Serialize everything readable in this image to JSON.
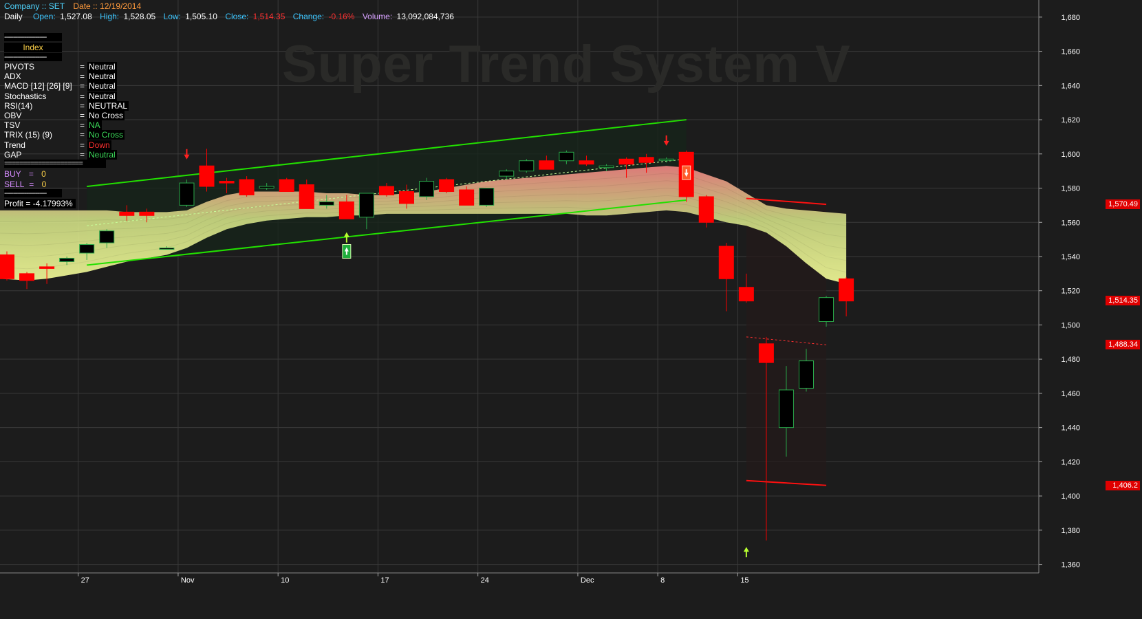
{
  "header": {
    "company_label": "Company :: SET",
    "date_label": "Date :: 12/19/2014",
    "period": "Daily",
    "open_label": "Open:",
    "open": "1,527.08",
    "high_label": "High:",
    "high": "1,528.05",
    "low_label": "Low:",
    "low": "1,505.10",
    "close_label": "Close:",
    "close": "1,514.35",
    "change_label": "Change:",
    "change": "-0.16%",
    "volume_label": "Volume:",
    "volume": "13,092,084,736"
  },
  "watermark": "Super Trend System V",
  "panel": {
    "sep1": "-----------------------",
    "index_label": "Index",
    "sep2": "-----------------------",
    "rows": [
      {
        "key": "PIVOTS",
        "eq": "=",
        "value": "Neutral",
        "color": "#ffffff"
      },
      {
        "key": "ADX",
        "eq": "=",
        "value": "Neutral",
        "color": "#ffffff"
      },
      {
        "key": "MACD [12] [26] [9]",
        "eq": "=",
        "value": "Neutral",
        "color": "#ffffff"
      },
      {
        "key": "Stochastics",
        "eq": "=",
        "value": "Neutral",
        "color": "#ffffff"
      },
      {
        "key": "RSI(14)",
        "eq": "=",
        "value": "NEUTRAL",
        "color": "#ffffff"
      },
      {
        "key": "OBV",
        "eq": "=",
        "value": "No Cross",
        "color": "#ffffff"
      },
      {
        "key": "TSV",
        "eq": "=",
        "value": "NA",
        "color": "#3cdc5a"
      },
      {
        "key": "TRIX (15) (9)",
        "eq": "=",
        "value": "No Cross",
        "color": "#3cdc5a"
      },
      {
        "key": "Trend",
        "eq": "=",
        "value": "Down",
        "color": "#ff3030"
      },
      {
        "key": "GAP",
        "eq": "=",
        "value": "Neutral",
        "color": "#3cdc5a"
      }
    ],
    "sep3": "=====================",
    "buy_label": "BUY",
    "buy_eq": "=",
    "buy_value": "0",
    "sell_label": "SELL",
    "sell_eq": "=",
    "sell_value": "0",
    "sep4": "-----------------------",
    "profit": "Profit = -4.17993%"
  },
  "price_tags": [
    {
      "text": "1,570.49",
      "value": 1570.49,
      "color": "#e00000"
    },
    {
      "text": "1,514.35",
      "value": 1514.35,
      "color": "#e00000"
    },
    {
      "text": "1,488.34",
      "value": 1488.34,
      "color": "#e00000"
    },
    {
      "text": "1,406.2",
      "value": 1406.2,
      "color": "#e00000"
    }
  ],
  "colors": {
    "background": "#1c1c1c",
    "grid": "#3a3a3a",
    "up": "#000000",
    "down": "#ff0000",
    "channel": "#22e000",
    "axis_text": "#ffffff"
  },
  "chart_data": {
    "type": "candlestick",
    "title": "Super Trend System V",
    "ylim": [
      1355,
      1690
    ],
    "yticks": [
      1360,
      1380,
      1400,
      1420,
      1440,
      1460,
      1480,
      1500,
      1520,
      1540,
      1560,
      1580,
      1600,
      1620,
      1640,
      1660,
      1680
    ],
    "ytick_labels": [
      "1,360",
      "1,380",
      "1,400",
      "1,420",
      "1,440",
      "1,460",
      "1,480",
      "1,500",
      "1,520",
      "1,540",
      "1,560",
      "1,580",
      "1,600",
      "1,620",
      "1,640",
      "1,660",
      "1,680"
    ],
    "xtick_labels": [
      {
        "label": "27",
        "index": 4
      },
      {
        "label": "Nov",
        "index": 9
      },
      {
        "label": "10",
        "index": 14
      },
      {
        "label": "17",
        "index": 19
      },
      {
        "label": "24",
        "index": 24
      },
      {
        "label": "Dec",
        "index": 29
      },
      {
        "label": "8",
        "index": 33
      },
      {
        "label": "15",
        "index": 37
      }
    ],
    "candles": [
      {
        "o": 1541,
        "h": 1543,
        "l": 1526,
        "c": 1527
      },
      {
        "o": 1530,
        "h": 1531,
        "l": 1521,
        "c": 1526
      },
      {
        "o": 1534,
        "h": 1536,
        "l": 1524,
        "c": 1533
      },
      {
        "o": 1537,
        "h": 1540,
        "l": 1535,
        "c": 1539
      },
      {
        "o": 1542,
        "h": 1548,
        "l": 1538,
        "c": 1547
      },
      {
        "o": 1548,
        "h": 1556,
        "l": 1545,
        "c": 1555
      },
      {
        "o": 1566,
        "h": 1570,
        "l": 1561,
        "c": 1564
      },
      {
        "o": 1566,
        "h": 1568,
        "l": 1560,
        "c": 1564
      },
      {
        "o": 1545,
        "h": 1546,
        "l": 1544,
        "c": 1545
      },
      {
        "o": 1570,
        "h": 1585,
        "l": 1569,
        "c": 1583
      },
      {
        "o": 1593,
        "h": 1603,
        "l": 1578,
        "c": 1581
      },
      {
        "o": 1584,
        "h": 1586,
        "l": 1577,
        "c": 1583
      },
      {
        "o": 1585,
        "h": 1587,
        "l": 1575,
        "c": 1576
      },
      {
        "o": 1580,
        "h": 1583,
        "l": 1579,
        "c": 1581
      },
      {
        "o": 1585,
        "h": 1586,
        "l": 1578,
        "c": 1578
      },
      {
        "o": 1582,
        "h": 1585,
        "l": 1568,
        "c": 1568
      },
      {
        "o": 1570,
        "h": 1576,
        "l": 1568,
        "c": 1572
      },
      {
        "o": 1572,
        "h": 1576,
        "l": 1562,
        "c": 1562
      },
      {
        "o": 1563,
        "h": 1577,
        "l": 1556,
        "c": 1577
      },
      {
        "o": 1581,
        "h": 1583,
        "l": 1575,
        "c": 1576
      },
      {
        "o": 1578,
        "h": 1582,
        "l": 1568,
        "c": 1571
      },
      {
        "o": 1575,
        "h": 1586,
        "l": 1573,
        "c": 1584
      },
      {
        "o": 1585,
        "h": 1586,
        "l": 1577,
        "c": 1578
      },
      {
        "o": 1579,
        "h": 1581,
        "l": 1570,
        "c": 1570
      },
      {
        "o": 1570,
        "h": 1580,
        "l": 1569,
        "c": 1580
      },
      {
        "o": 1587,
        "h": 1591,
        "l": 1585,
        "c": 1590
      },
      {
        "o": 1590,
        "h": 1597,
        "l": 1589,
        "c": 1596
      },
      {
        "o": 1596,
        "h": 1599,
        "l": 1591,
        "c": 1591
      },
      {
        "o": 1596,
        "h": 1602,
        "l": 1594,
        "c": 1601
      },
      {
        "o": 1596,
        "h": 1599,
        "l": 1593,
        "c": 1594
      },
      {
        "o": 1592,
        "h": 1594,
        "l": 1590,
        "c": 1593
      },
      {
        "o": 1597,
        "h": 1598,
        "l": 1586,
        "c": 1594
      },
      {
        "o": 1598,
        "h": 1600,
        "l": 1589,
        "c": 1595
      },
      {
        "o": 1597,
        "h": 1598,
        "l": 1595,
        "c": 1597
      },
      {
        "o": 1601,
        "h": 1602,
        "l": 1572,
        "c": 1575
      },
      {
        "o": 1575,
        "h": 1576,
        "l": 1557,
        "c": 1560
      },
      {
        "o": 1546,
        "h": 1548,
        "l": 1508,
        "c": 1527
      },
      {
        "o": 1522,
        "h": 1530,
        "l": 1513,
        "c": 1514
      },
      {
        "o": 1489,
        "h": 1493,
        "l": 1374,
        "c": 1478
      },
      {
        "o": 1440,
        "h": 1476,
        "l": 1423,
        "c": 1462
      },
      {
        "o": 1463,
        "h": 1486,
        "l": 1461,
        "c": 1479
      },
      {
        "o": 1502,
        "h": 1517,
        "l": 1499,
        "c": 1516
      },
      {
        "o": 1527,
        "h": 1528,
        "l": 1505,
        "c": 1514
      }
    ],
    "channel_upper": {
      "from_index": 4,
      "to_index": 34,
      "from_value": 1581,
      "to_value": 1620
    },
    "channel_lower": {
      "from_index": 4,
      "to_index": 34,
      "from_value": 1535,
      "to_value": 1573
    },
    "channel_mid": {
      "from_index": 4,
      "to_index": 34,
      "from_value": 1558,
      "to_value": 1597
    },
    "down_channel_upper": {
      "from_index": 37,
      "to_index": 41,
      "from_value": 1574,
      "to_value": 1570.49
    },
    "down_channel_mid": {
      "from_index": 37,
      "to_index": 41,
      "from_value": 1493,
      "to_value": 1488.34
    },
    "down_channel_lower": {
      "from_index": 37,
      "to_index": 41,
      "from_value": 1409,
      "to_value": 1406.2
    },
    "ribbon_top": [
      1567,
      1567,
      1567,
      1567,
      1567,
      1567,
      1566,
      1566,
      1566,
      1567,
      1572,
      1576,
      1578,
      1578,
      1578,
      1578,
      1577,
      1577,
      1576,
      1576,
      1577,
      1578,
      1580,
      1582,
      1584,
      1585,
      1586,
      1587,
      1588,
      1589,
      1590,
      1591,
      1592,
      1593,
      1592,
      1588,
      1584,
      1577,
      1570,
      1568,
      1567,
      1566,
      1565
    ],
    "ribbon_bottom": [
      1527,
      1526,
      1527,
      1529,
      1531,
      1534,
      1537,
      1539,
      1541,
      1545,
      1551,
      1556,
      1559,
      1561,
      1562,
      1563,
      1563,
      1564,
      1564,
      1565,
      1565,
      1565,
      1565,
      1565,
      1565,
      1565,
      1565,
      1565,
      1565,
      1564,
      1564,
      1565,
      1566,
      1567,
      1566,
      1563,
      1560,
      1558,
      1554,
      1546,
      1536,
      1527,
      1524
    ],
    "signals": [
      {
        "index": 9,
        "type": "sell-arrow",
        "value": 1598
      },
      {
        "index": 17,
        "type": "buy-arrow",
        "value": 1553
      },
      {
        "index": 17,
        "type": "buy-box",
        "value": 1543
      },
      {
        "index": 33,
        "type": "sell-arrow",
        "value": 1606
      },
      {
        "index": 34,
        "type": "sell-box",
        "value": 1589
      },
      {
        "index": 37,
        "type": "buy-arrow",
        "value": 1369
      }
    ]
  }
}
